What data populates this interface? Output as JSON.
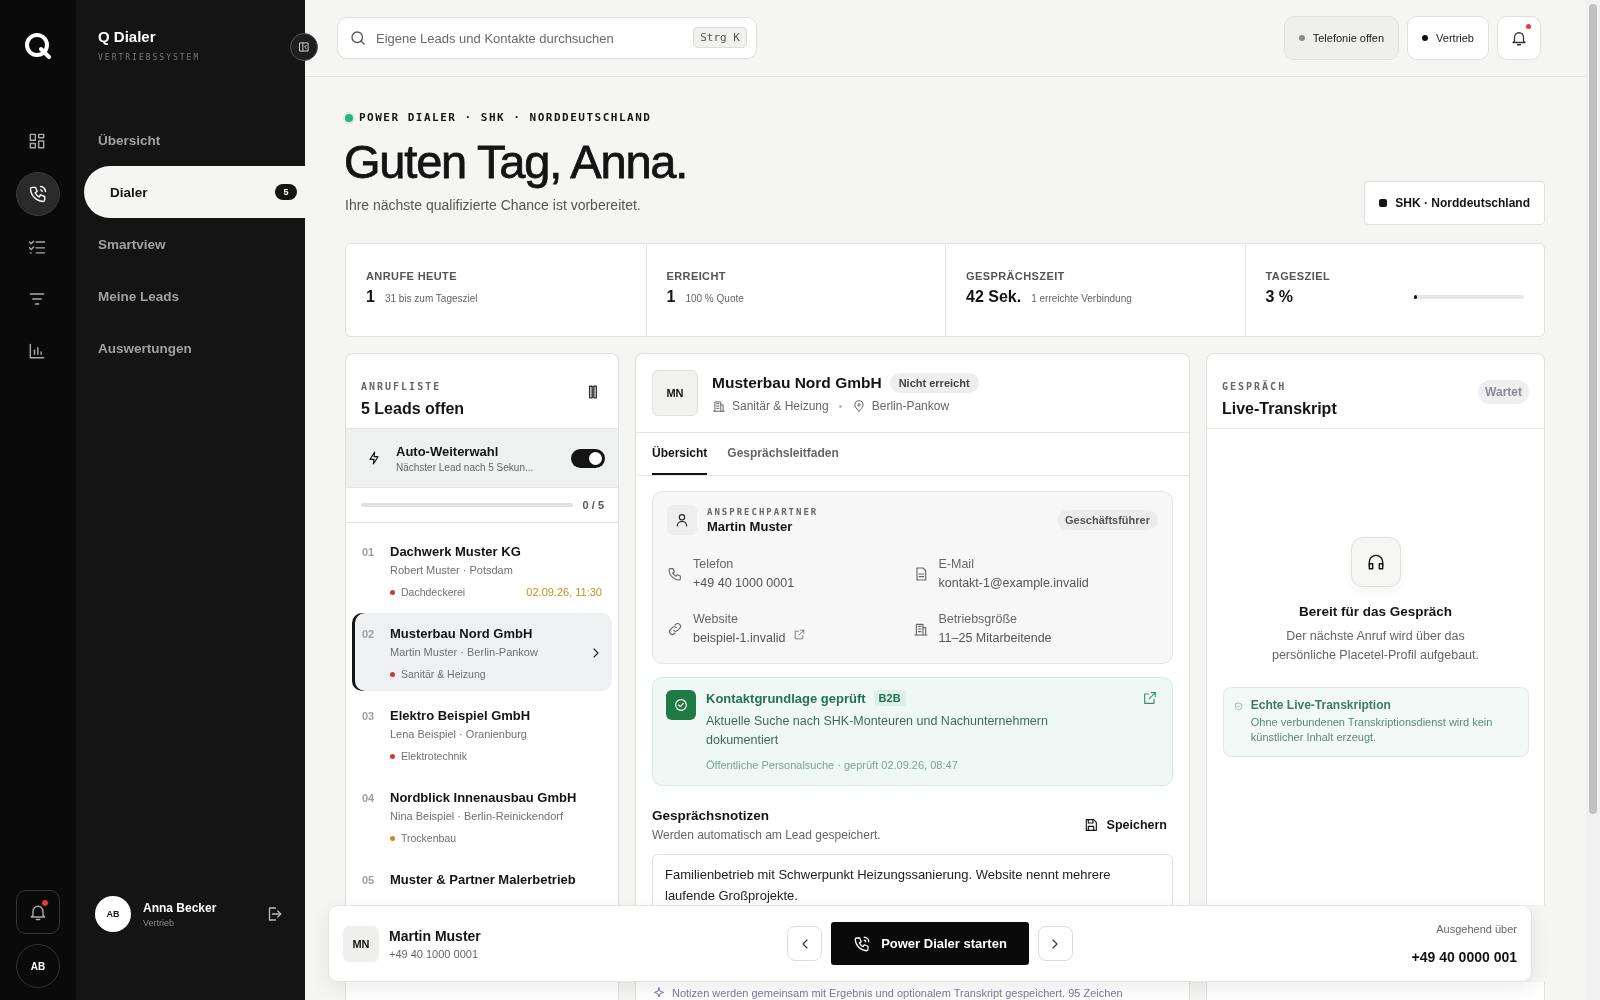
{
  "rail": {
    "items": [
      {
        "kind": "grid",
        "selected": false
      },
      {
        "kind": "phone",
        "selected": true
      },
      {
        "kind": "checklist",
        "selected": false
      },
      {
        "kind": "filter",
        "selected": false
      },
      {
        "kind": "chart",
        "selected": false
      }
    ],
    "notifications_unread": true,
    "avatar": "AB"
  },
  "sidebar": {
    "title": "Q Dialer",
    "subtitle": "VERTRIEBSSYSTEM",
    "items": [
      {
        "label": "Übersicht",
        "selected": false
      },
      {
        "label": "Dialer",
        "selected": true,
        "badge": "5"
      },
      {
        "label": "Smartview",
        "selected": false
      },
      {
        "label": "Meine Leads",
        "selected": false
      },
      {
        "label": "Auswertungen",
        "selected": false
      }
    ],
    "user": {
      "initials": "AB",
      "name": "Anna Becker",
      "role": "Vertrieb"
    }
  },
  "topbar": {
    "search": {
      "placeholder": "Eigene Leads und Kontakte durchsuchen",
      "shortcut": "Strg K"
    },
    "chips": [
      {
        "label": "Telefonie offen",
        "color": "#8a8a8a",
        "kind": "status"
      },
      {
        "label": "Vertrieb",
        "color": "#111111",
        "kind": "role"
      }
    ],
    "notifications_unread": true
  },
  "header": {
    "eyebrow": "POWER DIALER · SHK · NORDDEUTSCHLAND",
    "live": true,
    "title": "Guten Tag, Anna.",
    "subtitle": "Ihre nächste qualifizierte Chance ist vorbereitet.",
    "segment": "SHK · Norddeutschland"
  },
  "stats": [
    {
      "label": "ANRUFE HEUTE",
      "value": "1",
      "note": "31 bis zum Tagesziel"
    },
    {
      "label": "ERREICHT",
      "value": "1",
      "note": "100 % Quote"
    },
    {
      "label": "GESPRÄCHSZEIT",
      "value": "42 Sek.",
      "note": "1 erreichte Verbindung"
    },
    {
      "label": "TAGESZIEL",
      "value": "3 %",
      "level": 0.03
    }
  ],
  "call_list": {
    "eyebrow": "ANRUFLISTE",
    "title": "5 Leads offen",
    "auto_dial": {
      "title": "Auto-Weiterwahl",
      "subtitle": "Nächster Lead nach 5 Sekun...",
      "on": true
    },
    "progress": {
      "level": 0,
      "reading": "0 / 5"
    },
    "leads": [
      {
        "number": "01",
        "company": "Dachwerk Muster KG",
        "contact": "Robert Muster · Potsdam",
        "tag": "Dachdeckerei",
        "color": "#d0392b",
        "due": "02.09.26, 11:30",
        "selected": false
      },
      {
        "number": "02",
        "company": "Musterbau Nord GmbH",
        "contact": "Martin Muster · Berlin-Pankow",
        "tag": "Sanitär & Heizung",
        "color": "#d0392b",
        "selected": true
      },
      {
        "number": "03",
        "company": "Elektro Beispiel GmbH",
        "contact": "Lena Beispiel · Oranienburg",
        "tag": "Elektrotechnik",
        "color": "#d0392b",
        "selected": false
      },
      {
        "number": "04",
        "company": "Nordblick Innenausbau GmbH",
        "contact": "Nina Beispiel · Berlin-Reinickendorf",
        "tag": "Trockenbau",
        "color": "#c98a1a",
        "selected": false
      },
      {
        "number": "05",
        "company": "Muster & Partner Malerbetrieb",
        "selected": false
      }
    ]
  },
  "lead": {
    "initials": "MN",
    "company": "Musterbau Nord GmbH",
    "status": "Nicht erreicht",
    "industry": "Sanitär & Heizung",
    "city": "Berlin-Pankow",
    "tabs": [
      {
        "label": "Übersicht",
        "selected": true
      },
      {
        "label": "Gesprächsleitfaden",
        "selected": false
      }
    ],
    "contact": {
      "eyebrow": "ANSPRECHPARTNER",
      "name": "Martin Muster",
      "role": "Geschäftsführer",
      "fields": [
        {
          "kind": "phone",
          "label": "Telefon",
          "value": "+49 40 1000 0001"
        },
        {
          "kind": "mail",
          "label": "E-Mail",
          "value": "kontakt-1@example.invalid"
        },
        {
          "kind": "link",
          "label": "Website",
          "value": "beispiel-1.invalid",
          "external": true
        },
        {
          "kind": "building",
          "label": "Betriebsgröße",
          "value": "11–25 Mitarbeitende"
        }
      ]
    },
    "verification": {
      "title": "Kontaktgrundlage geprüft",
      "tag": "B2B",
      "text": "Aktuelle Suche nach SHK-Monteuren und Nachunternehmern dokumentiert",
      "source": "Öffentliche Personalsuche · geprüft 02.09.26, 08:47"
    },
    "notes": {
      "title": "Gesprächsnotizen",
      "subtitle": "Werden automatisch am Lead gespeichert.",
      "save": "Speichern",
      "value": "Familienbetrieb mit Schwerpunkt Heizungssanierung. Website nennt mehrere laufende Großprojekte.",
      "footer": "Notizen werden gemeinsam mit Ergebnis und optionalem Transkript gespeichert. 95 Zeichen"
    }
  },
  "transcript": {
    "eyebrow": "GESPRÄCH",
    "title": "Live-Transkript",
    "status": "Wartet",
    "empty_title": "Bereit für das Gespräch",
    "empty_text": "Der nächste Anruf wird über das persönliche Placetel-Profil aufgebaut.",
    "info_title": "Echte Live-Transkription",
    "info_text": "Ohne verbundenen Transkriptionsdienst wird kein künstlicher Inhalt erzeugt."
  },
  "call_bar": {
    "initials": "MN",
    "name": "Martin Muster",
    "phone": "+49 40 1000 0001",
    "start": "Power Dialer starten",
    "outbound_label": "Ausgehend über",
    "outbound_number": "+49 40 0000 001"
  }
}
